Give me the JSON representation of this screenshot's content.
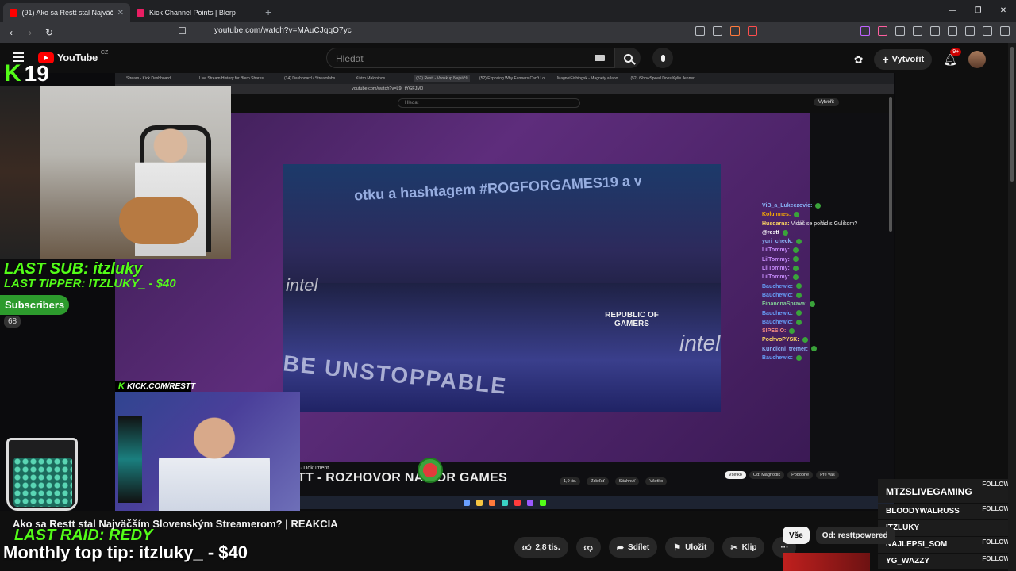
{
  "browser": {
    "tabs": [
      {
        "label": "(91) Ako sa Restt stal Najväčš",
        "active": true,
        "color": "#ff0000"
      },
      {
        "label": "Kick Channel Points | Blerp",
        "active": false,
        "color": "#e91e63"
      }
    ],
    "new_tab": "+",
    "url": "youtube.com/watch?v=MAuCJqqO7yc"
  },
  "youtube": {
    "logo_text": "YouTube",
    "region": "CZ",
    "search_placeholder": "Hledat",
    "create_label": "Vytvořit",
    "notif_badge": "9+"
  },
  "stream_overlay": {
    "kick_glyph": "K",
    "viewer_count": "19",
    "last_sub": "LAST SUB: itzluky",
    "last_tipper": "LAST TIPPER: ITZLUKY_ - $40",
    "subscribers_label": "Subscribers",
    "subscribers_count": "68",
    "kick_url": "KICK.COM/RESTT",
    "last_raid": "LAST RAID: REDY",
    "monthly_tip": "Monthly top tip: itzluky_ - $40",
    "follows": [
      {
        "name": "MTZSLIVEGAMING",
        "label": "FOLLOW"
      },
      {
        "name": "BLOODYWALRUSS",
        "label": "FOLLOW"
      },
      {
        "name": "ITZLUKY",
        "label": ""
      },
      {
        "name": "NAJLEPSI_SOM",
        "label": "FOLLOW"
      },
      {
        "name": "YG_WAZZY",
        "label": "FOLLOW"
      }
    ]
  },
  "inner_screen": {
    "tabs": [
      "Stream - Kick Dashboard",
      "Live Stream History for Blerp Shares",
      "(14) Dashboard / Streamlabs",
      "Kistro Maloninos",
      "(52) Restt - Vonskup Najväčš",
      "(52) Exposing Why Farmers Can't Lo",
      "MagnetFishingsk - Magnety a lano",
      "(52) iShowSpeed Does Kylie Jenner"
    ],
    "url": "youtube.com/watch?v=L9i_tYGFJM0",
    "search_placeholder": "Hledat",
    "create_label": "Vytvořit",
    "video_banner": "otku a hashtagem #ROGFORGAMES19 a v",
    "unstoppable": "BE UNSTOPPABLE",
    "rog": "REPUBLIC OF GAMERS",
    "intel": "intel",
    "video_title": "TT - ROZHOVOR NA ROR GAMES",
    "doc_label": "· Dokument",
    "actions": [
      "1,9 tis.",
      "Zdieľať",
      "Stiahnuť",
      "Všetko"
    ],
    "chips": [
      "Všetko",
      "Od: Magnodik",
      "Podobné",
      "Pre vás"
    ],
    "chat": [
      {
        "user": "ViB_a_Lukeczovic:",
        "msg": "",
        "color": "#8ab4f8"
      },
      {
        "user": "Kolumnes:",
        "msg": "",
        "color": "#f9ab00"
      },
      {
        "user": "Husqarna:",
        "msg": "Vidáš se pořád s Gulikom?",
        "color": "#fdd663"
      },
      {
        "user": "@restt",
        "msg": "",
        "color": "#ffffff"
      },
      {
        "user": "yuri_check:",
        "msg": "",
        "color": "#8ab4f8"
      },
      {
        "user": "LilTommy:",
        "msg": "",
        "color": "#c58af9"
      },
      {
        "user": "LilTommy:",
        "msg": "",
        "color": "#c58af9"
      },
      {
        "user": "LilTommy:",
        "msg": "",
        "color": "#c58af9"
      },
      {
        "user": "LilTommy:",
        "msg": "",
        "color": "#c58af9"
      },
      {
        "user": "Bauchewic:",
        "msg": "",
        "color": "#669df6"
      },
      {
        "user": "Bauchewic:",
        "msg": "",
        "color": "#669df6"
      },
      {
        "user": "FinancnaSprava:",
        "msg": "",
        "color": "#81c995"
      },
      {
        "user": "Bauchewic:",
        "msg": "",
        "color": "#669df6"
      },
      {
        "user": "Bauchewic:",
        "msg": "",
        "color": "#669df6"
      },
      {
        "user": "SIPESIO:",
        "msg": "",
        "color": "#f28b82"
      },
      {
        "user": "PochvoPYSK:",
        "msg": "",
        "color": "#fdd663"
      },
      {
        "user": "Kundicni_tremer:",
        "msg": "",
        "color": "#8ab4f8"
      },
      {
        "user": "Bauchewic:",
        "msg": "",
        "color": "#669df6"
      }
    ]
  },
  "video": {
    "title": "Ako sa Restt stal Najväčším Slovenským Streamerom? | REAKCIA",
    "like_count": "2,8 tis.",
    "share_label": "Sdílet",
    "save_label": "Uložit",
    "clip_label": "Klip",
    "more_label": "···"
  },
  "rec_chips": [
    "Vše",
    "Od: resttpowered"
  ]
}
